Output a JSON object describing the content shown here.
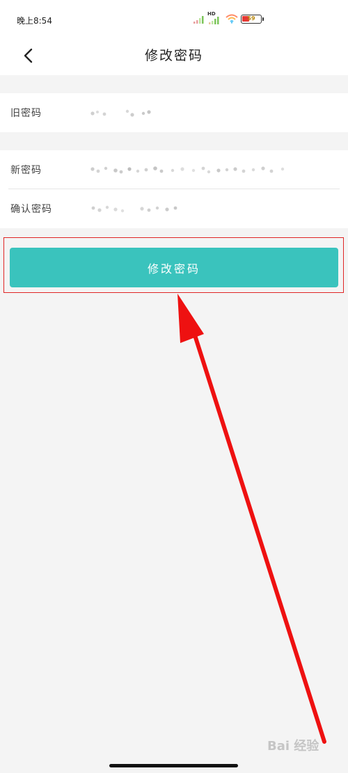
{
  "status_bar": {
    "time": "晚上8:54",
    "network_label": "HD",
    "battery": "59"
  },
  "nav": {
    "title": "修改密码"
  },
  "form": {
    "old_password": {
      "label": "旧密码"
    },
    "new_password": {
      "label": "新密码"
    },
    "confirm_password": {
      "label": "确认密码"
    }
  },
  "submit": {
    "label": "修改密码"
  },
  "watermark": {
    "text": "Bai 经验"
  },
  "colors": {
    "accent": "#3ac3bd",
    "annotation": "#e02424",
    "background": "#f4f4f4"
  }
}
